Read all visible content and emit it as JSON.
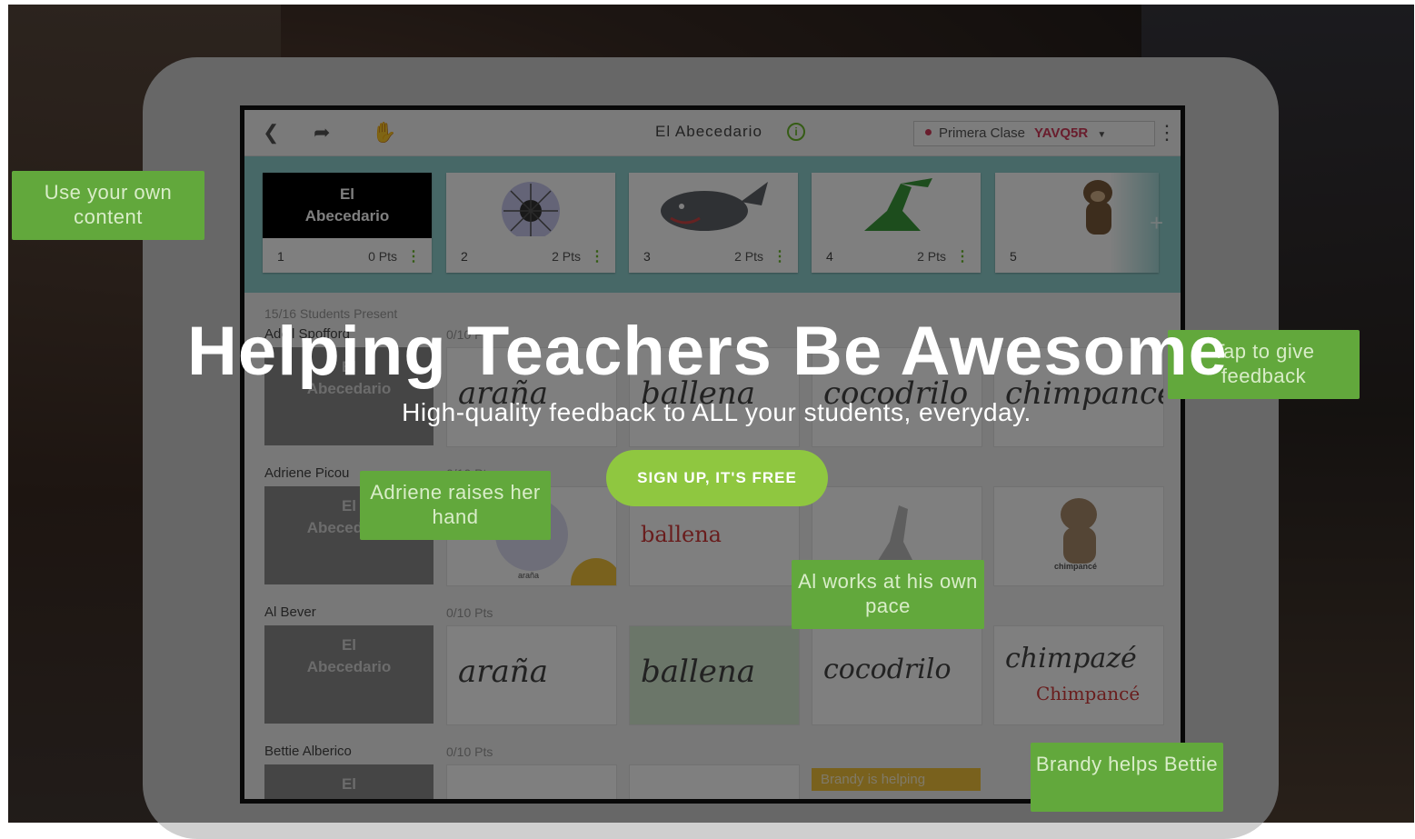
{
  "app": {
    "doc_title": "El Abecedario",
    "class_name": "Primera Clase",
    "class_code": "YAVQ5R",
    "accent": "#6bb82a",
    "class_color": "#d23a5a"
  },
  "icons": {
    "back": "back-chevron-icon",
    "share": "share-arrow-icon",
    "hand": "raised-hand-icon",
    "info": "info-icon",
    "menu": "kebab-menu-icon",
    "add": "plus-icon"
  },
  "slides": [
    {
      "num": "1",
      "pts": "0 Pts",
      "title_line1": "El",
      "title_line2": "Abecedario"
    },
    {
      "num": "2",
      "pts": "2 Pts"
    },
    {
      "num": "3",
      "pts": "2 Pts"
    },
    {
      "num": "4",
      "pts": "2 Pts"
    },
    {
      "num": "5",
      "pts": ""
    }
  ],
  "students": {
    "present": "15/16 Students Present",
    "rows": [
      {
        "name": "Adell Spofford",
        "pts": "0/10 Pts",
        "hands": "0",
        "helpers": "0",
        "words": [
          "araña",
          "ballena",
          "cocodrilo",
          "chimpancé"
        ]
      },
      {
        "name": "Adriene Picou",
        "pts": "0/10 Pts",
        "hands": "1",
        "helpers": "",
        "words": [
          "araña",
          "ballena",
          "",
          "chimpancé"
        ]
      },
      {
        "name": "Al Bever",
        "pts": "0/10 Pts",
        "hands": "0",
        "helpers": "0",
        "words": [
          "araña",
          "ballena",
          "cocodrilo",
          "chimpazé"
        ],
        "correction": "Chimpancé"
      },
      {
        "name": "Bettie Alberico",
        "pts": "0/10 Pts",
        "hands": "1",
        "helpers": "0",
        "helping_text": "Brandy is helping"
      }
    ],
    "first_cell_line1": "El",
    "first_cell_line2": "Abecedario"
  },
  "callouts": {
    "own_content": "Use your own content",
    "feedback": "Tap to give feedback",
    "raises_hand": "Adriene raises her hand",
    "own_pace": "Al works at his own pace",
    "helps": "Brandy helps Bettie"
  },
  "hero": {
    "title": "Helping Teachers Be Awesome",
    "subtitle": "High-quality feedback to ALL your students, everyday.",
    "cta": "SIGN UP, IT'S FREE",
    "cta_color": "#8fc740"
  }
}
